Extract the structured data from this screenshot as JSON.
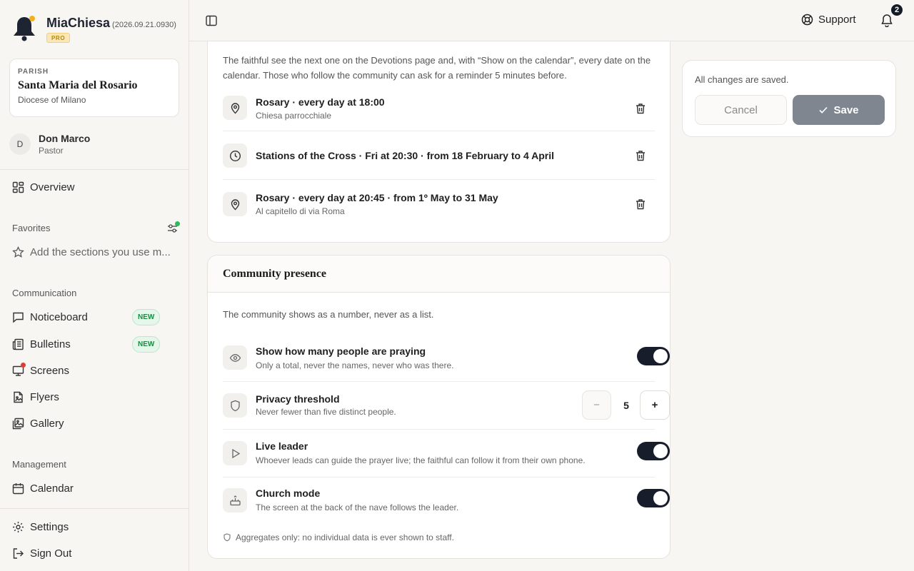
{
  "app": {
    "name": "MiaChiesa",
    "version": "(2026.09.21.0930)",
    "plan_badge": "PRO"
  },
  "parish": {
    "kicker": "PARISH",
    "name": "Santa Maria del Rosario",
    "diocese": "Diocese of Milano"
  },
  "user": {
    "initial": "D",
    "name": "Don Marco",
    "role": "Pastor"
  },
  "sidebar": {
    "overview": "Overview",
    "favorites_label": "Favorites",
    "favorites_add": "Add the sections you use m...",
    "communication_label": "Communication",
    "communication_items": [
      {
        "label": "Noticeboard",
        "badge": "NEW"
      },
      {
        "label": "Bulletins",
        "badge": "NEW"
      },
      {
        "label": "Screens"
      },
      {
        "label": "Flyers"
      },
      {
        "label": "Gallery"
      }
    ],
    "management_label": "Management",
    "management_items": [
      {
        "label": "Calendar"
      }
    ],
    "settings": "Settings",
    "sign_out": "Sign Out"
  },
  "topbar": {
    "support": "Support",
    "notifications_count": "2"
  },
  "devotions": {
    "intro": "The faithful see the next one on the Devotions page and, with “Show on the calendar”, every date on the calendar. Those who follow the community can ask for a reminder 5 minutes before.",
    "items": [
      {
        "icon": "location-pin-icon",
        "title": "Rosary · every day at 18:00",
        "subtitle": "Chiesa parrocchiale"
      },
      {
        "icon": "clock-icon",
        "title": "Stations of the Cross · Fri at 20:30 · from 18 February to 4 April",
        "subtitle": ""
      },
      {
        "icon": "location-pin-icon",
        "title": "Rosary · every day at 20:45 · from 1º May to 31 May",
        "subtitle": "Al capitello di via Roma"
      }
    ]
  },
  "community": {
    "title": "Community presence",
    "intro": "The community shows as a number, never as a list.",
    "show_count": {
      "title": "Show how many people are praying",
      "subtitle": "Only a total, never the names, never who was there.",
      "enabled": true
    },
    "privacy_threshold": {
      "title": "Privacy threshold",
      "subtitle": "Never fewer than five distinct people.",
      "value": "5",
      "minus": "−",
      "plus": "+"
    },
    "live_leader": {
      "title": "Live leader",
      "subtitle": "Whoever leads can guide the prayer live; the faithful can follow it from their own phone.",
      "enabled": true
    },
    "church_mode": {
      "title": "Church mode",
      "subtitle": "The screen at the back of the nave follows the leader.",
      "enabled": true
    },
    "footnote": "Aggregates only: no individual data is ever shown to staff."
  },
  "save_panel": {
    "status": "All changes are saved.",
    "cancel": "Cancel",
    "save": "Save"
  },
  "colors": {
    "primary_dark": "#181d2b",
    "save_disabled": "#80868f",
    "new_badge": "#1e8a42",
    "alert_dot": "#e53935",
    "online_dot": "#2fb95a",
    "pro_badge": "#b98700"
  }
}
